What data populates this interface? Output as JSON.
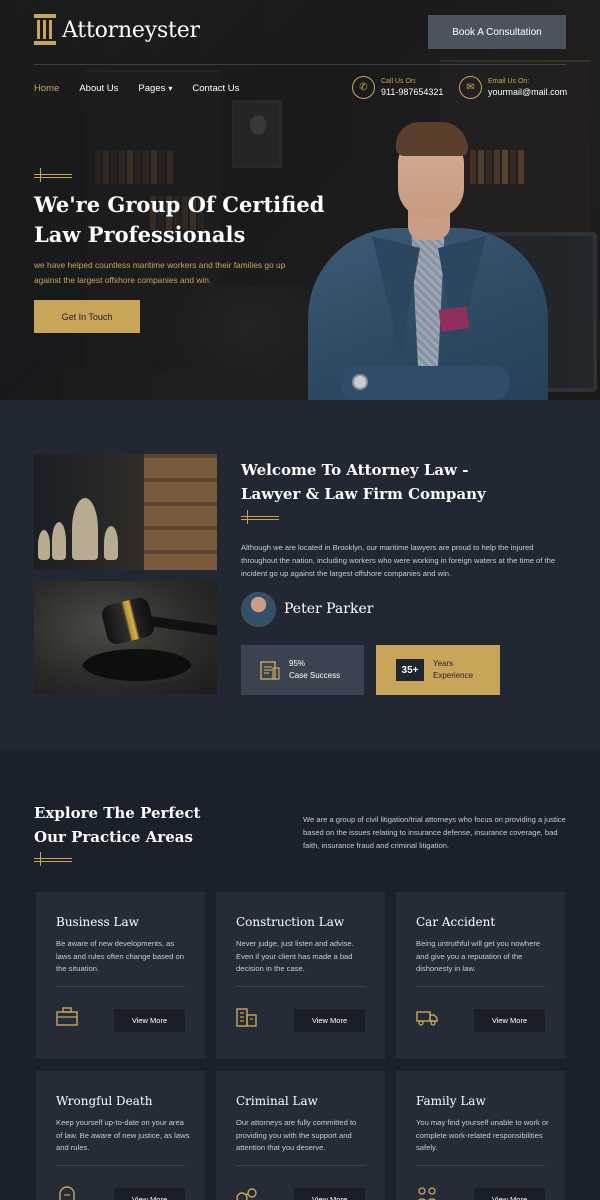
{
  "brand": {
    "name": "Attorneyster"
  },
  "header": {
    "cta_label": "Book A Consultation",
    "nav": [
      "Home",
      "About Us",
      "Pages",
      "Contact Us"
    ],
    "call": {
      "label": "Call Us On:",
      "value": "911-987654321"
    },
    "email": {
      "label": "Email Us On:",
      "value": "yourmail@mail.com"
    }
  },
  "hero": {
    "title_line1": "We're Group Of Certified",
    "title_line2": "Law Professionals",
    "subtitle": "we have helped countless maritime workers and their families go up against the largest offshore companies and win.",
    "cta_label": "Get In Touch"
  },
  "about": {
    "title_line1": "Welcome To Attorney Law -",
    "title_line2": "Lawyer & Law Firm Company",
    "text": "Although we are located in Brooklyn, our maritime lawyers are proud to help the injured throughout the nation, including workers who were working in foreign waters at the time of the incident go up against the largest offshore companies and win.",
    "person_name": "Peter Parker",
    "stat1": {
      "value": "95%",
      "label": "Case Success"
    },
    "stat2": {
      "value": "35+",
      "label_line1": "Years",
      "label_line2": "Experience"
    }
  },
  "practice": {
    "title_line1": "Explore The Perfect",
    "title_line2": "Our Practice Areas",
    "intro": "We are a group of civil litigation/trial attorneys who focus on providing a justice based on the issues relating to insurance defense, insurance coverage, bad faith, insurance fraud and criminal litigation.",
    "view_more_label": "View More",
    "areas": [
      {
        "title": "Business Law",
        "desc": "Be aware of new developments, as laws and rules often change based on the situation.",
        "icon": "briefcase-icon"
      },
      {
        "title": "Construction Law",
        "desc": "Never judge, just listen and advise. Even if your client has made a bad decision in the case.",
        "icon": "building-icon"
      },
      {
        "title": "Car Accident",
        "desc": "Being untruthful will get you nowhere and give you a reputation of the dishonesty in law.",
        "icon": "truck-icon"
      },
      {
        "title": "Wrongful Death",
        "desc": "Keep yourself up-to-date on your area of law. Be aware of new justice, as laws and rules.",
        "icon": "tombstone-icon"
      },
      {
        "title": "Criminal Law",
        "desc": "Our attorneys are fully committed to providing you with the support and attention that you deserve.",
        "icon": "handcuffs-icon"
      },
      {
        "title": "Family Law",
        "desc": "You may find yourself unable to work or complete work-related responsibilities safely.",
        "icon": "family-icon"
      }
    ]
  },
  "colors": {
    "gold": "#c9a55a",
    "navy": "#1b222c",
    "card": "#252c38"
  }
}
